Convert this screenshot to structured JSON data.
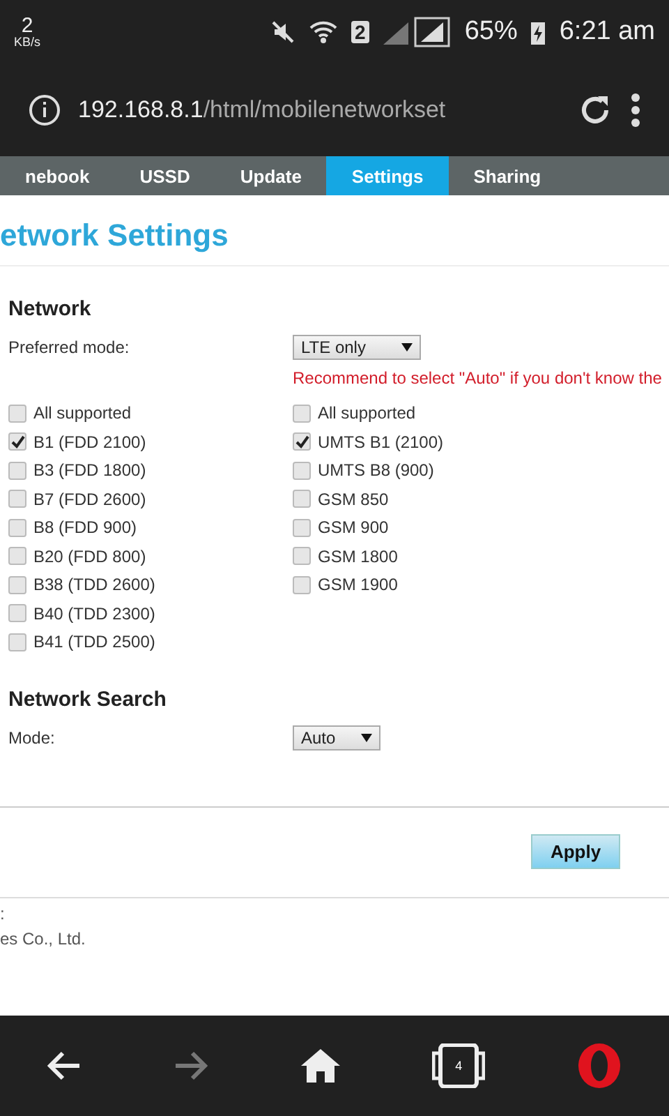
{
  "status_bar": {
    "speed": "2",
    "speed_unit": "KB/s",
    "sim_badge": "2",
    "battery": "65%",
    "time": "6:21 am"
  },
  "address_bar": {
    "url_host": "192.168.8.1",
    "url_path": "/html/mobilenetworkset"
  },
  "nav_tabs": [
    {
      "label": "nebook",
      "selected": false
    },
    {
      "label": "USSD",
      "selected": false
    },
    {
      "label": "Update",
      "selected": false
    },
    {
      "label": "Settings",
      "selected": true
    },
    {
      "label": "Sharing",
      "selected": false
    }
  ],
  "page_title": "etwork Settings",
  "network": {
    "heading": "Network",
    "preferred_mode_label": "Preferred mode:",
    "preferred_mode_value": "LTE only",
    "warning": "Recommend to select \"Auto\" if you don't know the",
    "lte_bands": [
      {
        "label": "All supported",
        "checked": false
      },
      {
        "label": "B1 (FDD 2100)",
        "checked": true
      },
      {
        "label": "B3 (FDD 1800)",
        "checked": false
      },
      {
        "label": "B7 (FDD 2600)",
        "checked": false
      },
      {
        "label": "B8 (FDD 900)",
        "checked": false
      },
      {
        "label": "B20 (FDD 800)",
        "checked": false
      },
      {
        "label": "B38 (TDD 2600)",
        "checked": false
      },
      {
        "label": "B40 (TDD 2300)",
        "checked": false
      },
      {
        "label": "B41 (TDD 2500)",
        "checked": false
      }
    ],
    "gsm_umts_bands": [
      {
        "label": "All supported",
        "checked": false
      },
      {
        "label": "UMTS B1 (2100)",
        "checked": true
      },
      {
        "label": "UMTS B8 (900)",
        "checked": false
      },
      {
        "label": "GSM 850",
        "checked": false
      },
      {
        "label": "GSM 900",
        "checked": false
      },
      {
        "label": "GSM 1800",
        "checked": false
      },
      {
        "label": "GSM 1900",
        "checked": false
      }
    ]
  },
  "network_search": {
    "heading": "Network Search",
    "mode_label": "Mode:",
    "mode_value": "Auto"
  },
  "apply_button": "Apply",
  "footer": [
    ":",
    "es Co., Ltd."
  ],
  "bottom_nav": {
    "tab_count": "4"
  }
}
